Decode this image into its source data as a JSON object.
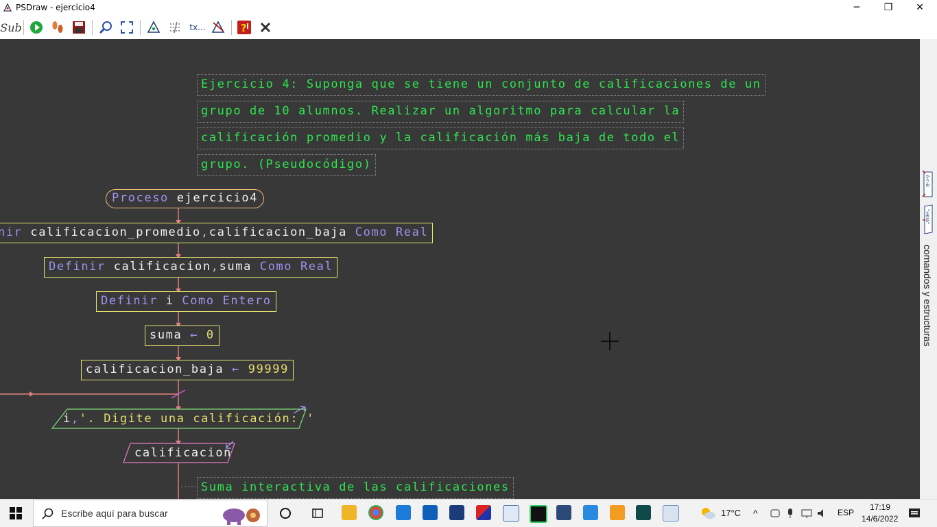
{
  "window": {
    "title": "PSDraw - ejercicio4",
    "minimize_label": "─",
    "restore_label": "❐",
    "close_label": "✕"
  },
  "toolbar": {
    "sub_label": "Sub",
    "text_tool_label": "tx..."
  },
  "comment": {
    "lines": [
      "Ejercicio 4: Suponga que se tiene un conjunto de calificaciones de un",
      "grupo de 10 alumnos. Realizar un algoritmo para calcular la",
      "calificación promedio y la calificación más baja de todo el",
      "grupo. (Pseudocódigo)"
    ]
  },
  "flow": {
    "proceso_kw": "Proceso",
    "proceso_name": "ejercicio4",
    "def1": {
      "kw": "nir",
      "vars1": "calificacion_promedio",
      "sep": ",",
      "vars2": "calificacion_baja",
      "type": "Como Real"
    },
    "def2": {
      "kw": "Definir",
      "vars1": "calificacion",
      "sep": ",",
      "vars2": "suma",
      "type": "Como Real"
    },
    "def3": {
      "kw": "Definir",
      "vars1": "i",
      "type": "Como Entero"
    },
    "assign1": {
      "var": "suma",
      "arrow": "←",
      "val": "0"
    },
    "assign2": {
      "var": "calificacion_baja",
      "arrow": "←",
      "val": "99999"
    },
    "output": {
      "var": "i",
      "sep": ",",
      "str": "'. Digite una calificación: '"
    },
    "input": {
      "var": "calificacion"
    },
    "comment2": "Suma interactiva de las calificaciones"
  },
  "side_panel": {
    "label": "comandos y estructuras",
    "tab1": "A<-B",
    "tab2": "\"Hola\""
  },
  "taskbar": {
    "search_placeholder": "Escribe aquí para buscar",
    "temperature": "17°C",
    "language": "ESP",
    "time": "17:19",
    "date": "14/6/2022"
  }
}
